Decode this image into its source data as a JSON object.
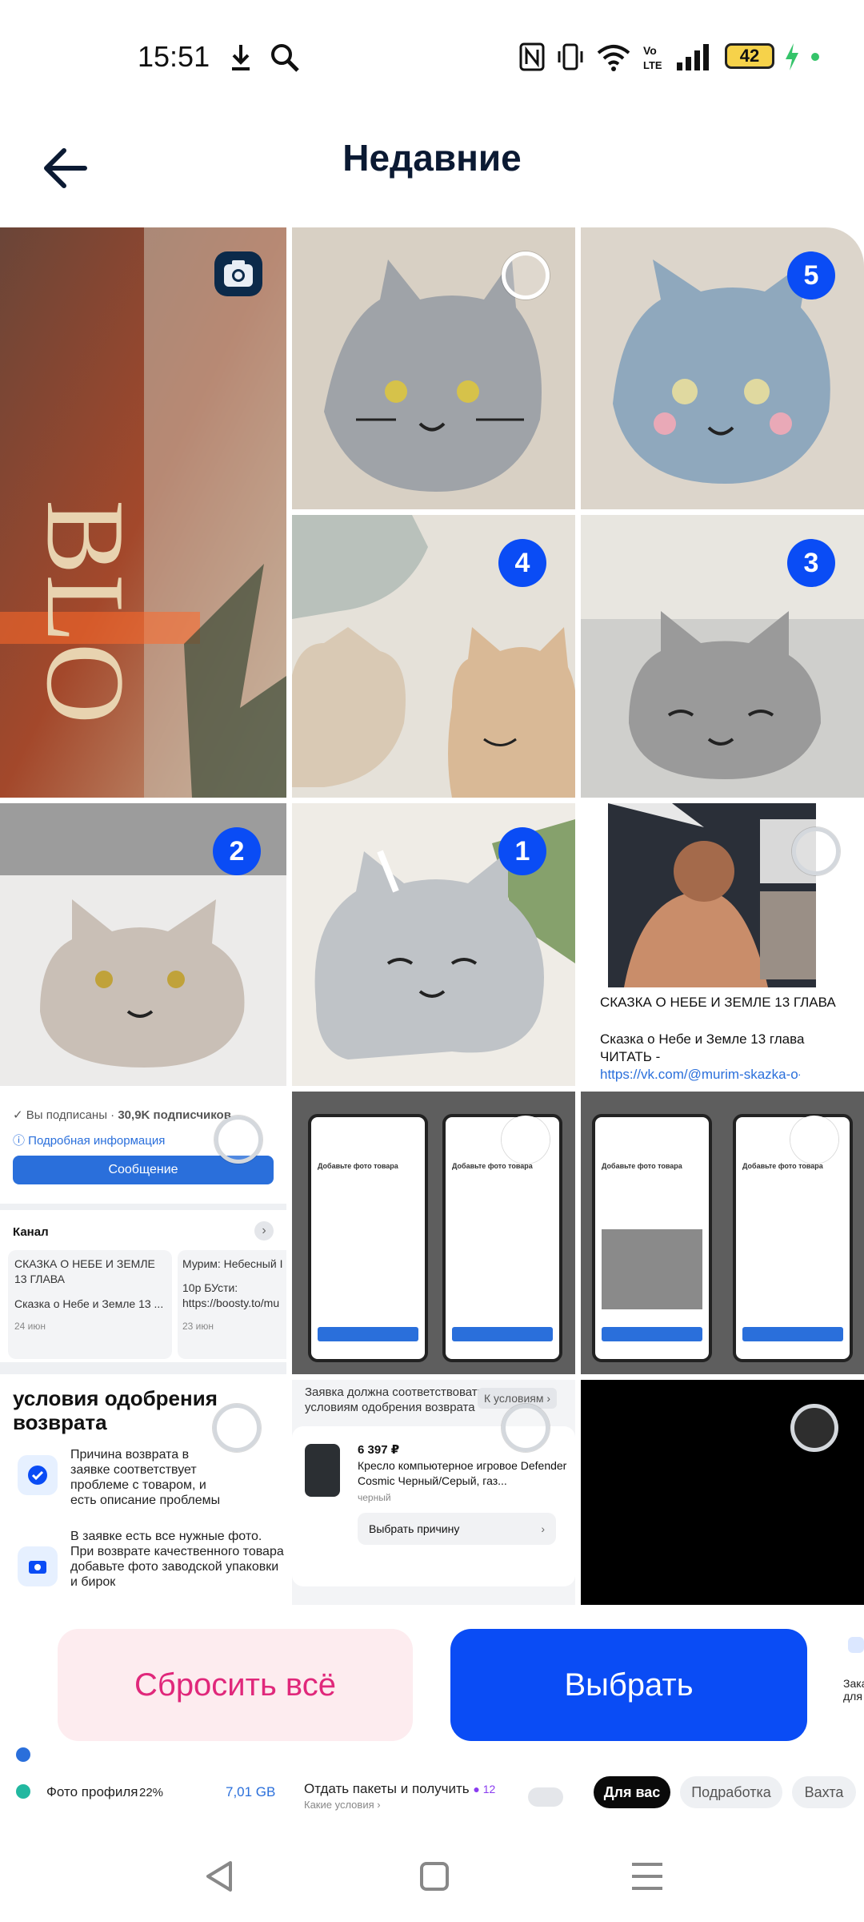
{
  "status_bar": {
    "time": "15:51",
    "battery": "42",
    "icons": [
      "download-icon",
      "search-icon",
      "nfc-icon",
      "vibrate-icon",
      "wifi-icon",
      "volte-icon",
      "signal-icon",
      "battery-icon",
      "charging-icon"
    ]
  },
  "header": {
    "title": "Недавние",
    "back_icon": "arrow-left-icon"
  },
  "grid": {
    "tile_1": {
      "kind": "photo",
      "camera_icon": "camera-icon"
    },
    "tile_2": {
      "kind": "photo",
      "selected": false
    },
    "tile_3": {
      "kind": "photo",
      "selection_number": "5"
    },
    "tile_4": {
      "kind": "photo",
      "selection_number": "4"
    },
    "tile_5": {
      "kind": "photo",
      "selection_number": "3"
    },
    "tile_6": {
      "kind": "photo",
      "selection_number": "2"
    },
    "tile_7": {
      "kind": "photo",
      "selection_number": "1"
    },
    "tile_8": {
      "kind": "screenshot",
      "caption": "СКАЗКА О НЕБЕ И ЗЕМЛЕ 13 ГЛАВА",
      "text_line_1": "Сказка о Небе и Земле 13 глава",
      "text_line_2": "ЧИТАТЬ -",
      "link": "https://vk.com/@murim-skazka-o-nebe-i-ze"
    },
    "tile_9": {
      "kind": "screenshot",
      "subscribed": "Вы подписаны",
      "subscribers": "30,9K подписчиков",
      "details_link": "Подробная информация",
      "message_button": "Сообщение",
      "channel_label": "Канал",
      "card_1_title": "СКАЗКА О НЕБЕ И ЗЕМЛЕ 13 ГЛАВА",
      "card_1_text": "Сказка о Небе и Земле 13 ...",
      "card_1_date": "24 июн",
      "card_2_title": "Мурим: Небесный I",
      "card_2_text": "10р БУсти: https://boosty.to/mu",
      "card_2_date": "23 июн"
    },
    "tile_10": {
      "kind": "screenshot",
      "screen_title": "Добавьте фото товара",
      "save_label": "Сохранить"
    },
    "tile_11": {
      "kind": "screenshot",
      "screen_title": "Добавьте фото товара",
      "save_label": "Сохранить"
    },
    "tile_12": {
      "kind": "screenshot",
      "heading": "условия одобрения возврата",
      "item_1": "Причина возврата в заявке соответствует проблеме с товаром, и есть описание проблемы",
      "item_2": "В заявке есть все нужные фото. При возврате качественного товара добавьте фото заводской упаковки и бирок"
    },
    "tile_13": {
      "kind": "screenshot",
      "note": "Заявка должна соответствовать условиям одобрения возврата",
      "conditions_link": "К условиям",
      "price": "6 397 ₽",
      "product": "Кресло компьютерное игровое Defender Cosmic Черный/Серый, газ...",
      "color": "черный",
      "choose_reason": "Выбрать причину"
    },
    "tile_14": {
      "kind": "photo",
      "dark": true
    }
  },
  "actions": {
    "reset_label": "Сбросить всё",
    "select_label": "Выбрать"
  },
  "under_app": {
    "profile_photo": "Фото профиля",
    "percent": "22%",
    "size": "7,01 GB",
    "promo": "Отдать пакеты и получить",
    "promo_count": "12",
    "promo_sub": "Какие условия",
    "chips": [
      "Для вас",
      "Подработка",
      "Вахта"
    ],
    "side_text": "Зака для"
  },
  "nav": {
    "back_icon": "nav-back-icon",
    "home_icon": "nav-home-icon",
    "menu_icon": "nav-menu-icon"
  },
  "colors": {
    "accent_blue": "#0a4cf5",
    "reset_bg": "#fdecef",
    "reset_text": "#e0287b",
    "title": "#0b1a33"
  }
}
